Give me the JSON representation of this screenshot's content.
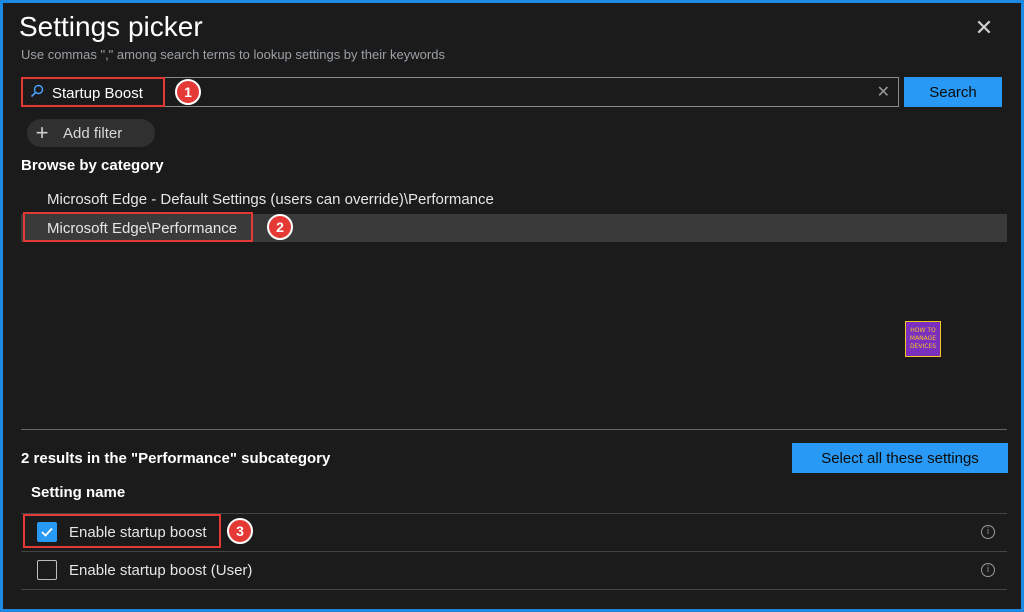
{
  "dialog": {
    "title": "Settings picker",
    "subtitle": "Use commas \",\" among search terms to lookup settings by their keywords",
    "close_icon": "✕"
  },
  "search": {
    "value": "Startup Boost",
    "placeholder": "",
    "button_label": "Search",
    "clear_icon": "✕"
  },
  "filter": {
    "add_label": "Add filter",
    "plus_icon": "+"
  },
  "browse": {
    "heading": "Browse by category",
    "categories": [
      {
        "label": "Microsoft Edge - Default Settings (users can override)\\Performance",
        "selected": false
      },
      {
        "label": "Microsoft Edge\\Performance",
        "selected": true
      }
    ]
  },
  "callouts": [
    "1",
    "2",
    "3"
  ],
  "logo": {
    "lines": [
      "HOW TO",
      "MANAGE",
      "DEVICES"
    ]
  },
  "results": {
    "summary": "2 results in the \"Performance\" subcategory",
    "select_all_label": "Select all these settings",
    "column_header": "Setting name",
    "rows": [
      {
        "label": "Enable startup boost",
        "checked": true
      },
      {
        "label": "Enable startup boost (User)",
        "checked": false
      }
    ]
  },
  "colors": {
    "accent": "#2899f5",
    "callout": "#e53935",
    "border": "#1e88e5"
  }
}
